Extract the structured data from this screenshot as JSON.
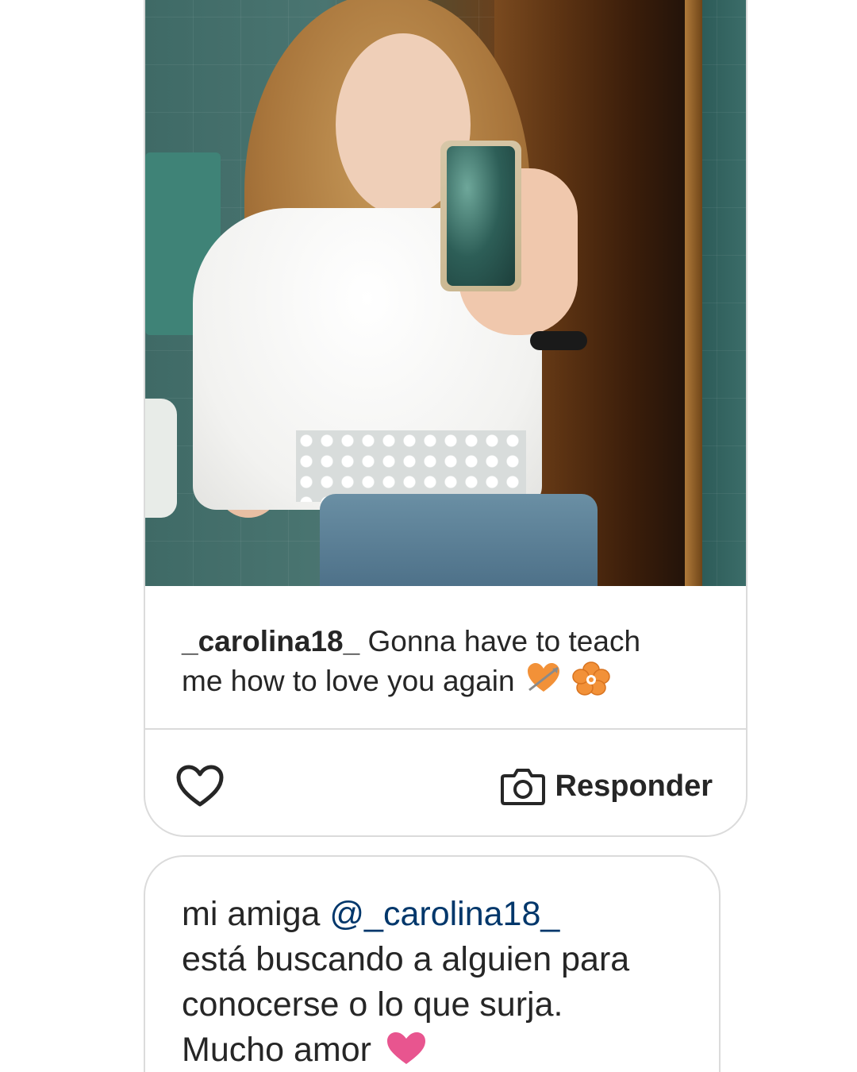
{
  "story": {
    "caption_username": "_carolina18_",
    "caption_text_line1": "Gonna have to teach",
    "caption_text_line2": "me how to love you again",
    "emoji_1": "heart-with-arrow-icon",
    "emoji_2": "hibiscus-icon"
  },
  "actions": {
    "like_icon": "heart-outline-icon",
    "reply_icon": "camera-icon",
    "reply_label": "Responder"
  },
  "message": {
    "prefix": "mi amiga ",
    "mention": "@_carolina18_",
    "line2": "está buscando a alguien para",
    "line3": "conocerse o lo que surja.",
    "line4": "Mucho amor",
    "emoji": "pink-heart-icon"
  },
  "colors": {
    "text": "#262626",
    "mention": "#00376b",
    "border": "#dbdbdb",
    "heart_pink": "#e8558f",
    "emoji_orange": "#f29138"
  }
}
